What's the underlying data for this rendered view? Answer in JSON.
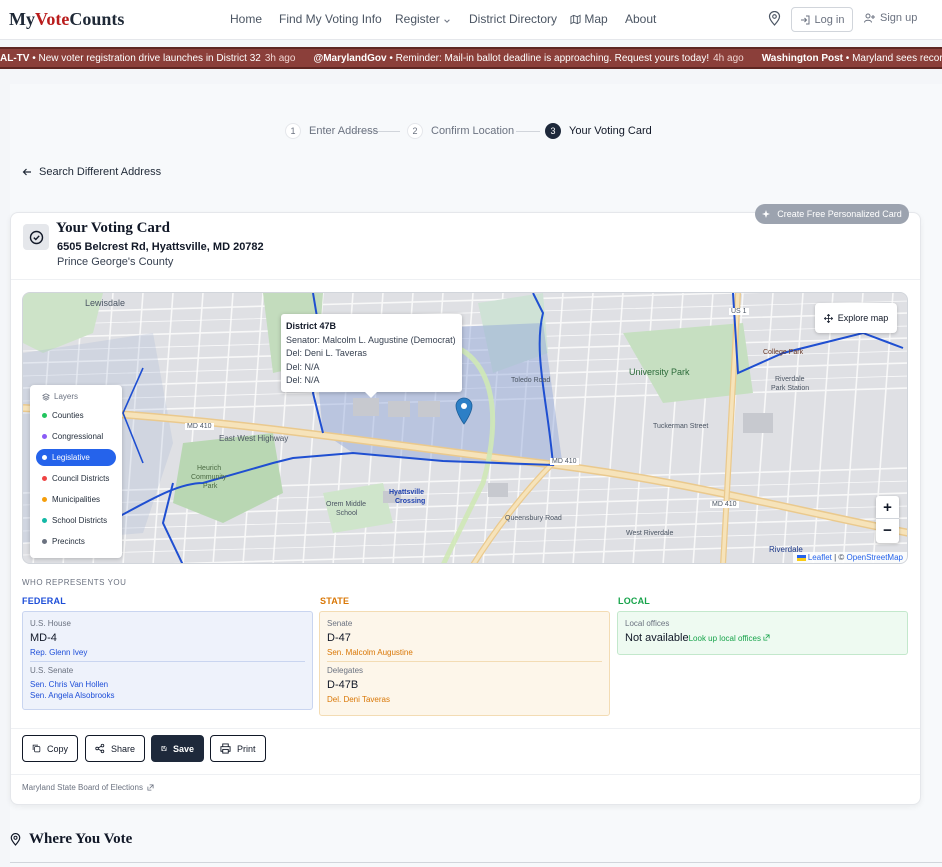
{
  "header": {
    "logo_part1": "My",
    "logo_part2": "Vote",
    "logo_part3": "Counts",
    "nav": {
      "home": "Home",
      "find": "Find My Voting Info",
      "register": "Register",
      "directory": "District Directory",
      "map": "Map",
      "about": "About"
    },
    "login": "Log in",
    "signup": "Sign up"
  },
  "ticker": [
    {
      "source": "AL-TV",
      "text": "New voter registration drive launches in District 32",
      "time": "3h ago"
    },
    {
      "source": "@MarylandGov",
      "text": "Reminder: Mail-in ballot deadline is approaching. Request yours today!",
      "time": "4h ago"
    },
    {
      "source": "Washington Post",
      "text": "Maryland sees record",
      "time": ""
    }
  ],
  "stepper": {
    "step1": {
      "num": "1",
      "label": "Enter Address"
    },
    "step2": {
      "num": "2",
      "label": "Confirm Location"
    },
    "step3": {
      "num": "3",
      "label": "Your Voting Card"
    }
  },
  "back_link": "Search Different Address",
  "card": {
    "personalize_button": "Create Free Personalized Card",
    "title": "Your Voting Card",
    "address": "6505 Belcrest Rd, Hyattsville, MD 20782",
    "county": "Prince George's County"
  },
  "map": {
    "popup": {
      "title": "District 47B",
      "senator": "Senator: Malcolm L. Augustine (Democrat)",
      "del1": "Del: Deni L. Taveras",
      "del2": "Del: N/A",
      "del3": "Del: N/A"
    },
    "layers_title": "Layers",
    "layers": [
      {
        "label": "Counties",
        "color": "#22c55e",
        "active": false
      },
      {
        "label": "Congressional",
        "color": "#8b5cf6",
        "active": false
      },
      {
        "label": "Legislative",
        "color": "#ffffff",
        "active": true
      },
      {
        "label": "Council Districts",
        "color": "#ef4444",
        "active": false
      },
      {
        "label": "Municipalities",
        "color": "#f59e0b",
        "active": false
      },
      {
        "label": "School Districts",
        "color": "#14b8a6",
        "active": false
      },
      {
        "label": "Precincts",
        "color": "#6b7280",
        "active": false
      }
    ],
    "explore_button": "Explore map",
    "zoom_in": "+",
    "zoom_out": "−",
    "attribution_leaflet": "Leaflet",
    "attribution_sep": " | © ",
    "attribution_osm": "OpenStreetMap",
    "labels": {
      "lewisdale": "Lewisdale",
      "md410_a": "MD 410",
      "md410_b": "MD 410",
      "md410_c": "MD 410",
      "ewh": "East West Highway",
      "hcp1": "Heurich",
      "hcp2": "Community",
      "hcp3": "Park",
      "orem1": "Orem Middle",
      "orem2": "School",
      "hyc1": "Hyattsville",
      "hyc2": "Crossing",
      "univpark": "University Park",
      "riverdale1": "Riverdale",
      "riverdale2": "Park Station",
      "collegepark": "College Park",
      "wriverdale": "West Riverdale",
      "queensbury": "Queensbury Road",
      "toledo": "Toledo Road",
      "tuckerman": "Tuckerman Street",
      "us1": "US 1",
      "riverdale3": "Riverdale"
    }
  },
  "representation": {
    "header": "WHO REPRESENTS YOU",
    "federal": {
      "title": "FEDERAL",
      "house_label": "U.S. House",
      "house_value": "MD-4",
      "house_rep": "Rep. Glenn Ivey",
      "senate_label": "U.S. Senate",
      "senator1": "Sen. Chris Van Hollen",
      "senator2": "Sen. Angela Alsobrooks"
    },
    "state": {
      "title": "STATE",
      "senate_label": "Senate",
      "senate_value": "D-47",
      "senator": "Sen. Malcolm Augustine",
      "delegates_label": "Delegates",
      "delegates_value": "D-47B",
      "delegate": "Del. Deni Taveras"
    },
    "local": {
      "title": "LOCAL",
      "label": "Local offices",
      "value": "Not available",
      "link": "Look up local offices"
    }
  },
  "actions": {
    "copy": "Copy",
    "share": "Share",
    "save": "Save",
    "print": "Print"
  },
  "source": "Maryland State Board of Elections",
  "where_vote": "Where You Vote",
  "colors": {
    "federal_bg": "#eef2fb",
    "state_bg": "#fdf6ea",
    "local_bg": "#eefaf1",
    "federal_accent": "#1d4ed8",
    "state_accent": "#d97706",
    "local_accent": "#16a34a"
  }
}
